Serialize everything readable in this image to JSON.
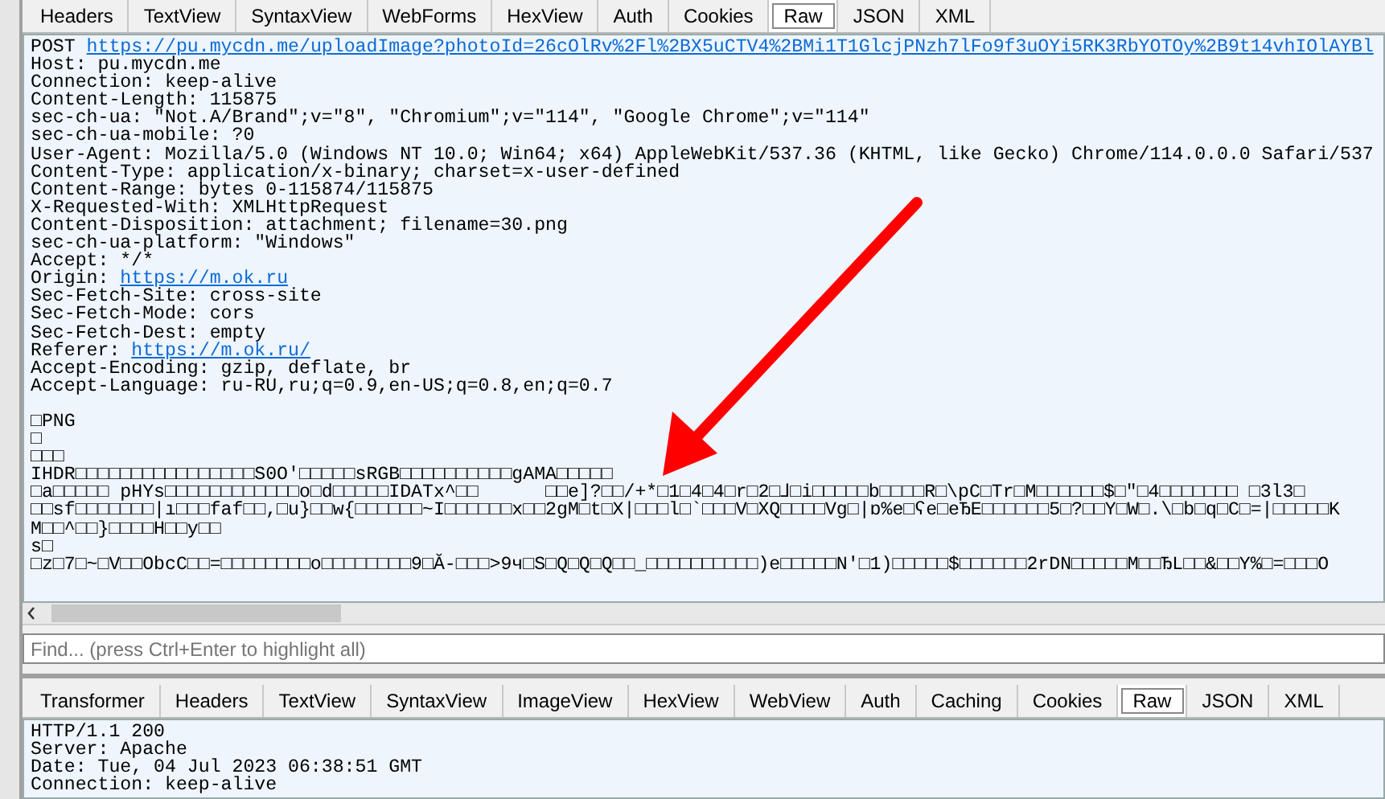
{
  "request_tabs": [
    {
      "label": "Headers",
      "selected": false
    },
    {
      "label": "TextView",
      "selected": false
    },
    {
      "label": "SyntaxView",
      "selected": false
    },
    {
      "label": "WebForms",
      "selected": false
    },
    {
      "label": "HexView",
      "selected": false
    },
    {
      "label": "Auth",
      "selected": false
    },
    {
      "label": "Cookies",
      "selected": false
    },
    {
      "label": "Raw",
      "selected": true
    },
    {
      "label": "JSON",
      "selected": false
    },
    {
      "label": "XML",
      "selected": false
    }
  ],
  "request_lines": [
    {
      "kind": "link",
      "label": "POST ",
      "link": "https://pu.mycdn.me/uploadImage?photoId=26cOlRv%2Fl%2BX5uCTV4%2BMi1T1GlcjPNzh7lFo9f3uOYi5RK3RbYOTOy%2B9t14vhIOlAYBl"
    },
    {
      "kind": "text",
      "text": "Host: pu.mycdn.me"
    },
    {
      "kind": "text",
      "text": "Connection: keep-alive"
    },
    {
      "kind": "text",
      "text": "Content-Length: 115875"
    },
    {
      "kind": "text",
      "text": "sec-ch-ua: \"Not.A/Brand\";v=\"8\", \"Chromium\";v=\"114\", \"Google Chrome\";v=\"114\""
    },
    {
      "kind": "text",
      "text": "sec-ch-ua-mobile: ?0"
    },
    {
      "kind": "text",
      "text": "User-Agent: Mozilla/5.0 (Windows NT 10.0; Win64; x64) AppleWebKit/537.36 (KHTML, like Gecko) Chrome/114.0.0.0 Safari/537"
    },
    {
      "kind": "text",
      "text": "Content-Type: application/x-binary; charset=x-user-defined"
    },
    {
      "kind": "text",
      "text": "Content-Range: bytes 0-115874/115875"
    },
    {
      "kind": "text",
      "text": "X-Requested-With: XMLHttpRequest"
    },
    {
      "kind": "text",
      "text": "Content-Disposition: attachment; filename=30.png"
    },
    {
      "kind": "text",
      "text": "sec-ch-ua-platform: \"Windows\""
    },
    {
      "kind": "text",
      "text": "Accept: */*"
    },
    {
      "kind": "link",
      "label": "Origin: ",
      "link": "https://m.ok.ru"
    },
    {
      "kind": "text",
      "text": "Sec-Fetch-Site: cross-site"
    },
    {
      "kind": "text",
      "text": "Sec-Fetch-Mode: cors"
    },
    {
      "kind": "text",
      "text": "Sec-Fetch-Dest: empty"
    },
    {
      "kind": "link",
      "label": "Referer: ",
      "link": "https://m.ok.ru/"
    },
    {
      "kind": "text",
      "text": "Accept-Encoding: gzip, deflate, br"
    },
    {
      "kind": "text",
      "text": "Accept-Language: ru-RU,ru;q=0.9,en-US;q=0.8,en;q=0.7"
    },
    {
      "kind": "blank"
    },
    {
      "kind": "text",
      "text": "□PNG"
    },
    {
      "kind": "text",
      "text": "□"
    },
    {
      "kind": "text",
      "text": "□□□"
    },
    {
      "kind": "text",
      "text": "IHDR□□□□□□□□□□□□□□□□S0O'□□□□□sRGB□□□□□□□□□□gAMA□□□□□"
    },
    {
      "kind": "text",
      "text": "□a□□□□□ pHYs□□□□□□□□□□□□o□d□□□□□IDATx^□□      □□e]?□□/+*□1□4□4□r□2□⅃□i□□□□□b□□□□R□\\pC□Tr□M□□□□□□$□\"□4□□□□□□□ □3l3□"
    },
    {
      "kind": "text",
      "text": "□□sf□□□□□□□|ı□□□faf□□,□u}□□w{□□□□□□~I□□□□□□x□□2gM□t□X|□□□l□`□□□V□XQ□□□□Vg□|ɒ%e□ʕe□eЂE□□□□□□5□?□□Y□W□.\\□b□q□C□=|□□□□□K"
    },
    {
      "kind": "text",
      "text": "M□□^□□}□□□□H□□y□□"
    },
    {
      "kind": "text",
      "text": "s□"
    },
    {
      "kind": "text",
      "text": "□z□7□~□V□□ObcC□□=□□□□□□□□o□□□□□□□□9□Ă-□□□>9ч□S□Q□Q□Q□□_□□□□□□□□□□)e□□□□□N'□1)□□□□□$□□□□□□2rDN□□□□□M□□ЂL□□&□□Y%□=□□□O"
    }
  ],
  "find": {
    "placeholder": "Find... (press Ctrl+Enter to highlight all)"
  },
  "response_tabs": [
    {
      "label": "Transformer",
      "selected": false
    },
    {
      "label": "Headers",
      "selected": false
    },
    {
      "label": "TextView",
      "selected": false
    },
    {
      "label": "SyntaxView",
      "selected": false
    },
    {
      "label": "ImageView",
      "selected": false
    },
    {
      "label": "HexView",
      "selected": false
    },
    {
      "label": "WebView",
      "selected": false
    },
    {
      "label": "Auth",
      "selected": false
    },
    {
      "label": "Caching",
      "selected": false
    },
    {
      "label": "Cookies",
      "selected": false
    },
    {
      "label": "Raw",
      "selected": true
    },
    {
      "label": "JSON",
      "selected": false
    },
    {
      "label": "XML",
      "selected": false
    }
  ],
  "response_lines": [
    {
      "kind": "text",
      "text": "HTTP/1.1 200"
    },
    {
      "kind": "text",
      "text": "Server: Apache"
    },
    {
      "kind": "text",
      "text": "Date: Tue, 04 Jul 2023 06:38:51 GMT"
    },
    {
      "kind": "text",
      "text": "Connection: keep-alive"
    }
  ]
}
